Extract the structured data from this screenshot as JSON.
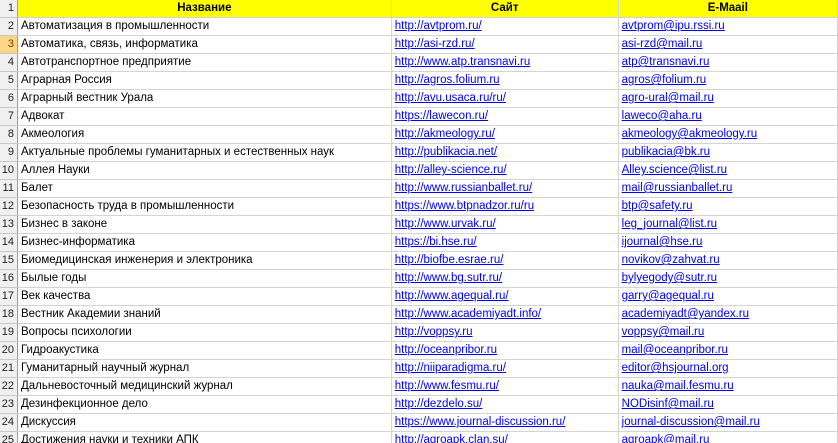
{
  "header": {
    "num": "1",
    "name": "Название",
    "site": "Сайт",
    "email": "E-Maail"
  },
  "selected_row": "3",
  "rows": [
    {
      "num": "2",
      "name": "Автоматизация в промышленности",
      "site": "http://avtprom.ru/",
      "email": "avtprom@ipu.rssi.ru"
    },
    {
      "num": "3",
      "name": "Автоматика, связь, информатика",
      "site": "http://asi-rzd.ru/",
      "email": "asi-rzd@mail.ru"
    },
    {
      "num": "4",
      "name": "Автотранспортное предприятие",
      "site": "http://www.atp.transnavi.ru",
      "email": "atp@transnavi.ru"
    },
    {
      "num": "5",
      "name": "Аграрная Россия",
      "site": "http://agros.folium.ru",
      "email": "agros@folium.ru"
    },
    {
      "num": "6",
      "name": "Аграрный вестник Урала",
      "site": "http://avu.usaca.ru/ru/",
      "email": "agro-ural@mail.ru"
    },
    {
      "num": "7",
      "name": "Адвокат",
      "site": "https://lawecon.ru/",
      "email": "laweco@aha.ru"
    },
    {
      "num": "8",
      "name": "Акмеология",
      "site": "http://akmeology.ru/",
      "email": "akmeology@akmeology.ru"
    },
    {
      "num": "9",
      "name": "Актуальные проблемы гуманитарных и естественных наук",
      "site": "http://publikacia.net/",
      "email": "publikacia@bk.ru"
    },
    {
      "num": "10",
      "name": "Аллея Науки",
      "site": "http://alley-science.ru/",
      "email": "Alley.science@list.ru"
    },
    {
      "num": "11",
      "name": "Балет",
      "site": "http://www.russianballet.ru/",
      "email": "mail@russianballet.ru"
    },
    {
      "num": "12",
      "name": "Безопасность труда в промышленности",
      "site": "https://www.btpnadzor.ru/ru",
      "email": "btp@safety.ru"
    },
    {
      "num": "13",
      "name": "Бизнес в законе",
      "site": "http://www.urvak.ru/",
      "email": "leg_journal@list.ru"
    },
    {
      "num": "14",
      "name": "Бизнес-информатика",
      "site": "https://bi.hse.ru/",
      "email": "ijournal@hse.ru"
    },
    {
      "num": "15",
      "name": "Биомедицинская инженерия и электроника",
      "site": "http://biofbe.esrae.ru/",
      "email": "novikov@zahvat.ru"
    },
    {
      "num": "16",
      "name": "Былые годы",
      "site": "http://www.bg.sutr.ru/",
      "email": "bylyegody@sutr.ru"
    },
    {
      "num": "17",
      "name": "Век качества",
      "site": "http://www.agequal.ru/",
      "email": "garry@agequal.ru"
    },
    {
      "num": "18",
      "name": "Вестник Академии знаний",
      "site": "http://www.academiyadt.info/",
      "email": "academiyadt@yandex.ru"
    },
    {
      "num": "19",
      "name": "Вопросы психологии",
      "site": "http://voppsy.ru",
      "email": "voppsy@mail.ru"
    },
    {
      "num": "20",
      "name": "Гидроакустика",
      "site": "http://oceanpribor.ru",
      "email": "mail@oceanpribor.ru"
    },
    {
      "num": "21",
      "name": "Гуманитарный научный журнал",
      "site": "http://niiparadigma.ru/",
      "email": "editor@hsjournal.org"
    },
    {
      "num": "22",
      "name": "Дальневосточный медицинский журнал",
      "site": "http://www.fesmu.ru/",
      "email": "nauka@mail.fesmu.ru"
    },
    {
      "num": "23",
      "name": "Дезинфекционное дело",
      "site": "http://dezdelo.su/",
      "email": "NODisinf@mail.ru"
    },
    {
      "num": "24",
      "name": "Дискуссия",
      "site": "https://www.journal-discussion.ru/",
      "email": "journal-discussion@mail.ru"
    },
    {
      "num": "25",
      "name": "Достижения науки и техники АПК",
      "site": "http://agroapk.clan.su/",
      "email": "agroapk@mail.ru"
    }
  ]
}
